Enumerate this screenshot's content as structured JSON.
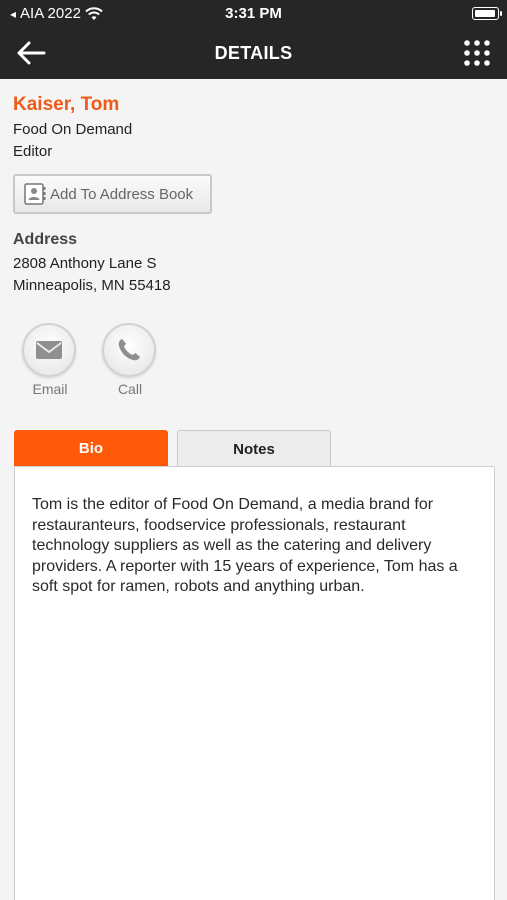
{
  "status_bar": {
    "carrier": "AIA 2022",
    "time": "3:31 PM"
  },
  "nav": {
    "title": "DETAILS"
  },
  "contact": {
    "name": "Kaiser, Tom",
    "company": "Food On Demand",
    "role": "Editor",
    "add_to_address_book": "Add To Address Book"
  },
  "address": {
    "heading": "Address",
    "line1": "2808 Anthony Lane S",
    "line2": "Minneapolis, MN 55418"
  },
  "actions": {
    "email_label": "Email",
    "call_label": "Call"
  },
  "tabs": [
    {
      "label": "Bio",
      "active": true
    },
    {
      "label": "Notes",
      "active": false
    }
  ],
  "bio": {
    "text": "Tom is the editor of Food On Demand, a media brand for restauranteurs, foodservice professionals, restaurant technology suppliers as well as the catering and delivery providers. A reporter with 15 years of experience, Tom has a soft spot for ramen, robots and anything urban."
  },
  "colors": {
    "accent": "#ff5a0a",
    "name": "#ef5a18",
    "topbar": "#262626"
  },
  "icons": {
    "back": "arrow-left-icon",
    "menu": "grid-menu-icon",
    "wifi": "wifi-icon",
    "battery": "battery-icon",
    "address_book": "contact-card-icon",
    "email": "envelope-icon",
    "call": "phone-icon"
  }
}
